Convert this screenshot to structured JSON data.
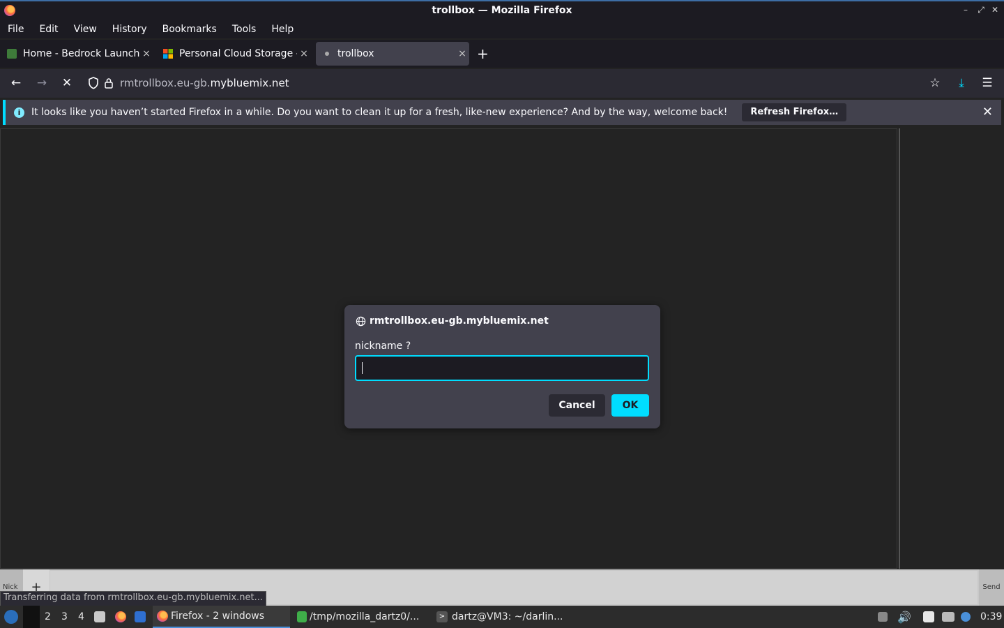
{
  "window": {
    "title": "trollbox — Mozilla Firefox"
  },
  "menu": [
    "File",
    "Edit",
    "View",
    "History",
    "Bookmarks",
    "Tools",
    "Help"
  ],
  "tabs": [
    {
      "label": "Home - Bedrock Launcher",
      "active": false
    },
    {
      "label": "Personal Cloud Storage - ",
      "active": false
    },
    {
      "label": "trollbox",
      "active": true
    }
  ],
  "urlbar": {
    "prefix": "rmtrollbox.eu-gb.",
    "domain": "mybluemix.net"
  },
  "notification": {
    "message": "It looks like you haven’t started Firefox in a while. Do you want to clean it up for a fresh, like-new experience? And by the way, welcome back!",
    "button": "Refresh Firefox…"
  },
  "dialog": {
    "origin": "rmtrollbox.eu-gb.mybluemix.net",
    "prompt": "nickname ?",
    "value": "",
    "cancel": "Cancel",
    "ok": "OK"
  },
  "chat": {
    "nick": "Nick",
    "plus": "+",
    "send": "Send"
  },
  "status": "Transferring data from rmtrollbox.eu-gb.mybluemix.net...",
  "taskbar": {
    "workspaces": [
      "2",
      "3",
      "4"
    ],
    "apps": [
      {
        "label": "Firefox - 2 windows",
        "active": true
      },
      {
        "label": "/tmp/mozilla_dartz0/...",
        "active": false
      },
      {
        "label": "dartz@VM3: ~/darlin...",
        "active": false
      }
    ],
    "clock": "0:39"
  },
  "colors": {
    "accent": "#00ddff",
    "surface": "#42414d",
    "chrome": "#1c1b22"
  }
}
